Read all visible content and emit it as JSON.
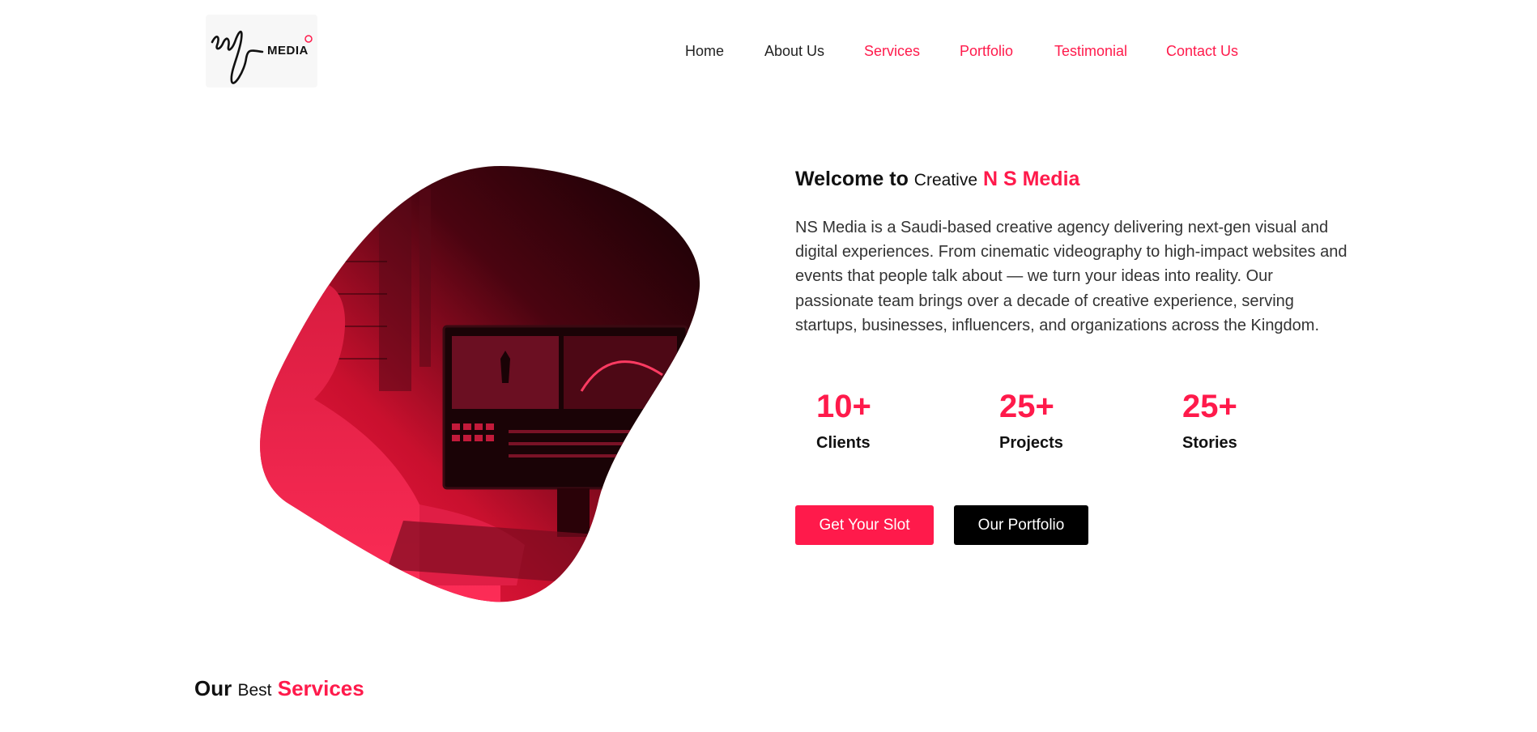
{
  "header": {
    "logo_text": "MEDIA",
    "nav": [
      {
        "label": "Home",
        "active": false
      },
      {
        "label": "About Us",
        "active": false
      },
      {
        "label": "Services",
        "active": true
      },
      {
        "label": "Portfolio",
        "active": true
      },
      {
        "label": "Testimonial",
        "active": true
      },
      {
        "label": "Contact Us",
        "active": true
      }
    ]
  },
  "hero": {
    "welcome_bold": "Welcome to",
    "welcome_light": "Creative",
    "welcome_brand": "N S Media",
    "description": "NS Media is a Saudi-based creative agency delivering next-gen visual and digital experiences. From cinematic videography to high-impact websites and events that people talk about — we turn your ideas into reality. Our passionate team brings over a decade of creative experience, serving startups, businesses, influencers, and organizations across the Kingdom.",
    "stats": [
      {
        "value": "10+",
        "label": "Clients"
      },
      {
        "value": "25+",
        "label": "Projects"
      },
      {
        "value": "25+",
        "label": "Stories"
      }
    ],
    "primary_button": "Get Your Slot",
    "secondary_button": "Our Portfolio"
  },
  "services": {
    "title_bold": "Our",
    "title_light": "Best",
    "title_accent": "Services"
  },
  "colors": {
    "accent": "#ff1a4b",
    "dark": "#000000",
    "text": "#333333"
  },
  "icons": {
    "logo": "ns-media-signature-logo",
    "hero_image": "video-editor-at-monitor-photo"
  }
}
